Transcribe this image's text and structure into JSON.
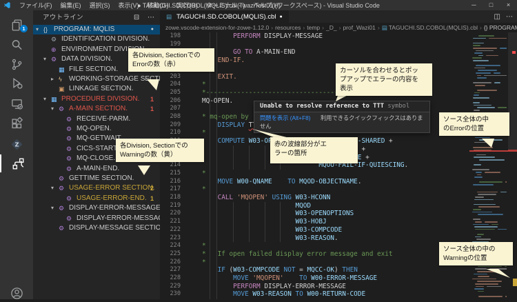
{
  "window": {
    "menus": [
      "ファイル(F)",
      "編集(E)",
      "選択(S)",
      "表示(V)",
      "移動(G)",
      "実行(R)",
      "ターミナル(T)",
      "ヘルプ(H)"
    ],
    "title": "● TAGUCHI.SD.COBOL(MQLIS).cbl - waziTest01 (ワークスペース) - Visual Studio Code",
    "controls": {
      "minimize": "─",
      "maximize": "□",
      "close": "×"
    }
  },
  "activity_bar": {
    "explorer_badge": "1"
  },
  "sidebar": {
    "title": "アウトライン",
    "actions": {
      "collapse_all": "⊟",
      "more": "⋯"
    },
    "outline": [
      {
        "label": "PROGRAM: MQLIS",
        "icon": "braces-icon",
        "lvl": 0,
        "chev": "e",
        "sel": true,
        "dot": true
      },
      {
        "label": "IDENTIFICATION DIVISION.",
        "icon": "wrench-icon",
        "lvl": 1
      },
      {
        "label": "ENVIRONMENT DIVISION.",
        "icon": "method-icon",
        "lvl": 1
      },
      {
        "label": "DATA DIVISION.",
        "icon": "gear-icon",
        "lvl": 1,
        "chev": "e"
      },
      {
        "label": "FILE SECTION.",
        "icon": "grid-icon",
        "lvl": 2
      },
      {
        "label": "WORKING-STORAGE SECTION.",
        "icon": "event-icon",
        "lvl": 2,
        "chev": "c"
      },
      {
        "label": "LINKAGE SECTION.",
        "icon": "package-icon",
        "lvl": 2
      },
      {
        "label": "PROCEDURE DIVISION.",
        "icon": "grid-icon",
        "lvl": 1,
        "chev": "e",
        "color": "error",
        "badge": "1"
      },
      {
        "label": "A-MAIN SECTION.",
        "icon": "gear-icon",
        "lvl": 2,
        "chev": "e",
        "color": "error",
        "badge": "1"
      },
      {
        "label": "RECEIVE-PARM.",
        "icon": "gear-icon",
        "lvl": 3
      },
      {
        "label": "MQ-OPEN.",
        "icon": "gear-icon",
        "lvl": 3
      },
      {
        "label": "MQ-GETWAIT.",
        "icon": "gear-icon",
        "lvl": 3
      },
      {
        "label": "CICS-START.",
        "icon": "gear-icon",
        "lvl": 3
      },
      {
        "label": "MQ-CLOSE.",
        "icon": "gear-icon",
        "lvl": 3
      },
      {
        "label": "A-MAIN-END.",
        "icon": "gear-icon",
        "lvl": 3
      },
      {
        "label": "GETTIME SECTION.",
        "icon": "gear-icon",
        "lvl": 2
      },
      {
        "label": "USAGE-ERROR SECTION.",
        "icon": "gear-icon",
        "lvl": 2,
        "chev": "e",
        "color": "warning",
        "badge": "2"
      },
      {
        "label": "USAGE-ERROR-END.",
        "icon": "gear-icon",
        "lvl": 3,
        "color": "warning",
        "badge": "1"
      },
      {
        "label": "DISPLAY-ERROR-MESSAGE SECTION.",
        "icon": "gear-icon",
        "lvl": 2,
        "chev": "e"
      },
      {
        "label": "DISPLAY-ERROR-MESSAGE-END.",
        "icon": "gear-icon",
        "lvl": 3
      },
      {
        "label": "DISPLAY-MESSAGE SECTION.",
        "icon": "gear-icon",
        "lvl": 2
      }
    ]
  },
  "editor": {
    "tab": {
      "label": "TAGUCHI.SD.COBOL(MQLIS).cbl",
      "modified_dot": "●"
    },
    "actions": {
      "split": "◫",
      "more": "⋯"
    },
    "breadcrumbs": [
      "zowe.vscode-extension-for-zowe-1.12.0",
      "resources",
      "temp",
      "_D_",
      "prof_Wazi01",
      "TAGUCHI.SD.COBOL(MQLIS).cbl",
      "{} PROGRAM: MQLIS"
    ],
    "lines": [
      {
        "n": 198,
        "t": [
          [
            "        ",
            ""
          ],
          [
            "PERFORM",
            "k2"
          ],
          [
            " ",
            ""
          ],
          [
            "DISPLAY-MESSAGE",
            "p"
          ]
        ]
      },
      {
        "n": 199,
        "t": []
      },
      {
        "n": 200,
        "t": [
          [
            "        ",
            ""
          ],
          [
            "GO TO",
            "k2"
          ],
          [
            " ",
            ""
          ],
          [
            "A-MAIN-END",
            "p"
          ]
        ]
      },
      {
        "n": 201,
        "t": [
          [
            "    ",
            ""
          ],
          [
            "END-IF.",
            "k3"
          ]
        ]
      },
      {
        "n": 202,
        "t": [
          [
            "*",
            "c"
          ]
        ]
      },
      {
        "n": 203,
        "t": [
          [
            "    ",
            ""
          ],
          [
            "EXIT.",
            "k3"
          ]
        ]
      },
      {
        "n": 204,
        "t": [
          [
            "*",
            "c"
          ]
        ]
      },
      {
        "n": 205,
        "t": [
          [
            "*-------------------------------------------",
            "c"
          ]
        ]
      },
      {
        "n": 206,
        "t": [
          [
            "MQ-OPEN.",
            "p"
          ]
        ]
      },
      {
        "n": 207,
        "t": []
      },
      {
        "n": 208,
        "t": [
          [
            "* mq-open by",
            "c"
          ]
        ]
      },
      {
        "n": 209,
        "t": [
          [
            "    ",
            ""
          ],
          [
            "DISPLAY",
            "k"
          ],
          [
            " ",
            ""
          ],
          [
            "TTT",
            "e"
          ],
          [
            ".",
            "p"
          ]
        ]
      },
      {
        "n": 210,
        "t": [
          [
            "*",
            "c"
          ]
        ]
      },
      {
        "n": 211,
        "t": [
          [
            "    ",
            ""
          ],
          [
            "COMPUTE",
            "k"
          ],
          [
            " ",
            ""
          ],
          [
            "W03-OPENOPTIONS",
            "v"
          ],
          [
            " ",
            ""
          ],
          [
            "=",
            "p"
          ],
          [
            " ",
            ""
          ],
          [
            "MQOO-INPUT-SHARED",
            "v"
          ],
          [
            " ",
            ""
          ],
          [
            "+",
            "p"
          ]
        ]
      },
      {
        "n": 212,
        "t": [
          [
            "                              ",
            ""
          ],
          [
            "MQOO-CO-OP",
            "v"
          ],
          [
            " ",
            ""
          ],
          [
            "+",
            "p"
          ]
        ]
      },
      {
        "n": 213,
        "t": [
          [
            "                              ",
            ""
          ],
          [
            "MQOO-BROWSE",
            "v"
          ],
          [
            " ",
            ""
          ],
          [
            "+",
            "p"
          ]
        ]
      },
      {
        "n": 214,
        "t": [
          [
            "                              ",
            ""
          ],
          [
            "MQOO-FAIL-IF-QUIESCING",
            "v"
          ],
          [
            ".",
            "p"
          ]
        ]
      },
      {
        "n": 215,
        "t": [
          [
            "*",
            "c"
          ]
        ]
      },
      {
        "n": 216,
        "t": [
          [
            "    ",
            ""
          ],
          [
            "MOVE",
            "k"
          ],
          [
            " ",
            ""
          ],
          [
            "W00-QNAME",
            "v"
          ],
          [
            "    ",
            ""
          ],
          [
            "TO",
            "k"
          ],
          [
            " ",
            ""
          ],
          [
            "MQOD-OBJECTNAME",
            "v"
          ],
          [
            ".",
            "p"
          ]
        ]
      },
      {
        "n": 217,
        "t": [
          [
            "*",
            "c"
          ]
        ]
      },
      {
        "n": 218,
        "t": [
          [
            "    ",
            ""
          ],
          [
            "CALL",
            "k2"
          ],
          [
            " ",
            ""
          ],
          [
            "'MQOPEN'",
            "s"
          ],
          [
            " ",
            ""
          ],
          [
            "USING",
            "k"
          ],
          [
            " ",
            ""
          ],
          [
            "W03-HCONN",
            "v"
          ]
        ]
      },
      {
        "n": 219,
        "t": [
          [
            "                        ",
            ""
          ],
          [
            "MQOD",
            "v"
          ]
        ]
      },
      {
        "n": 220,
        "t": [
          [
            "                        ",
            ""
          ],
          [
            "W03-OPENOPTIONS",
            "v"
          ]
        ]
      },
      {
        "n": 221,
        "t": [
          [
            "                        ",
            ""
          ],
          [
            "W03-HOBJ",
            "v"
          ]
        ]
      },
      {
        "n": 222,
        "t": [
          [
            "                        ",
            ""
          ],
          [
            "W03-COMPCODE",
            "v"
          ]
        ]
      },
      {
        "n": 223,
        "t": [
          [
            "                        ",
            ""
          ],
          [
            "W03-REASON",
            "v"
          ],
          [
            ".",
            "p"
          ]
        ]
      },
      {
        "n": 224,
        "t": [
          [
            "*",
            "c"
          ]
        ]
      },
      {
        "n": 225,
        "t": [
          [
            "*   If open failed display error message and exit",
            "c"
          ]
        ]
      },
      {
        "n": 226,
        "t": [
          [
            "*",
            "c"
          ]
        ]
      },
      {
        "n": 227,
        "t": [
          [
            "    ",
            ""
          ],
          [
            "IF",
            "k"
          ],
          [
            " (",
            "p"
          ],
          [
            "W03-COMPCODE",
            "v"
          ],
          [
            " ",
            ""
          ],
          [
            "NOT",
            "k"
          ],
          [
            " ",
            ""
          ],
          [
            "=",
            "p"
          ],
          [
            " ",
            ""
          ],
          [
            "MQCC-OK",
            "v"
          ],
          [
            ")",
            "p"
          ],
          [
            " ",
            ""
          ],
          [
            "THEN",
            "k"
          ]
        ]
      },
      {
        "n": 228,
        "t": [
          [
            "        ",
            ""
          ],
          [
            "MOVE",
            "k"
          ],
          [
            " ",
            ""
          ],
          [
            "'MQOPEN'",
            "s"
          ],
          [
            "    ",
            ""
          ],
          [
            "TO",
            "k"
          ],
          [
            " ",
            ""
          ],
          [
            "W00-ERROR-MESSAGE",
            "v"
          ]
        ]
      },
      {
        "n": 229,
        "t": [
          [
            "        ",
            ""
          ],
          [
            "PERFORM",
            "k2"
          ],
          [
            " ",
            ""
          ],
          [
            "DISPLAY-ERROR-MESSAGE",
            "p"
          ]
        ]
      },
      {
        "n": 230,
        "t": [
          [
            "        ",
            ""
          ],
          [
            "MOVE",
            "k"
          ],
          [
            " ",
            ""
          ],
          [
            "W03-REASON",
            "v"
          ],
          [
            " ",
            ""
          ],
          [
            "TO",
            "k"
          ],
          [
            " ",
            ""
          ],
          [
            "W00-RETURN-CODE",
            "v"
          ]
        ]
      }
    ]
  },
  "tooltip": {
    "message": "Unable to resolve reference to TTT",
    "message_suffix": " symbol",
    "link": "問題を表示 (Alt+F8)",
    "hint": "利用できるクイックフィックスはありません"
  },
  "annotations": [
    {
      "text": "各Division, Sectionでの\nErrorの数（赤）"
    },
    {
      "text": "各Division, Sectionでの\nWarningの数（黄）"
    },
    {
      "text": "カーソルを合わせるとポッ\nプアップでエラーの内容を\n表示"
    },
    {
      "text": "赤の波線部分がエ\nラーの箇所"
    },
    {
      "text": "ソース全体の中\nのErrorの位置"
    },
    {
      "text": "ソース全体の中の\nWarningの位置"
    }
  ],
  "colors": {
    "accent": "#007acc",
    "error": "#f14c4c",
    "warning": "#cca700",
    "error_text": "#e0564a",
    "warning_text": "#c9a637",
    "selection": "#094771"
  }
}
